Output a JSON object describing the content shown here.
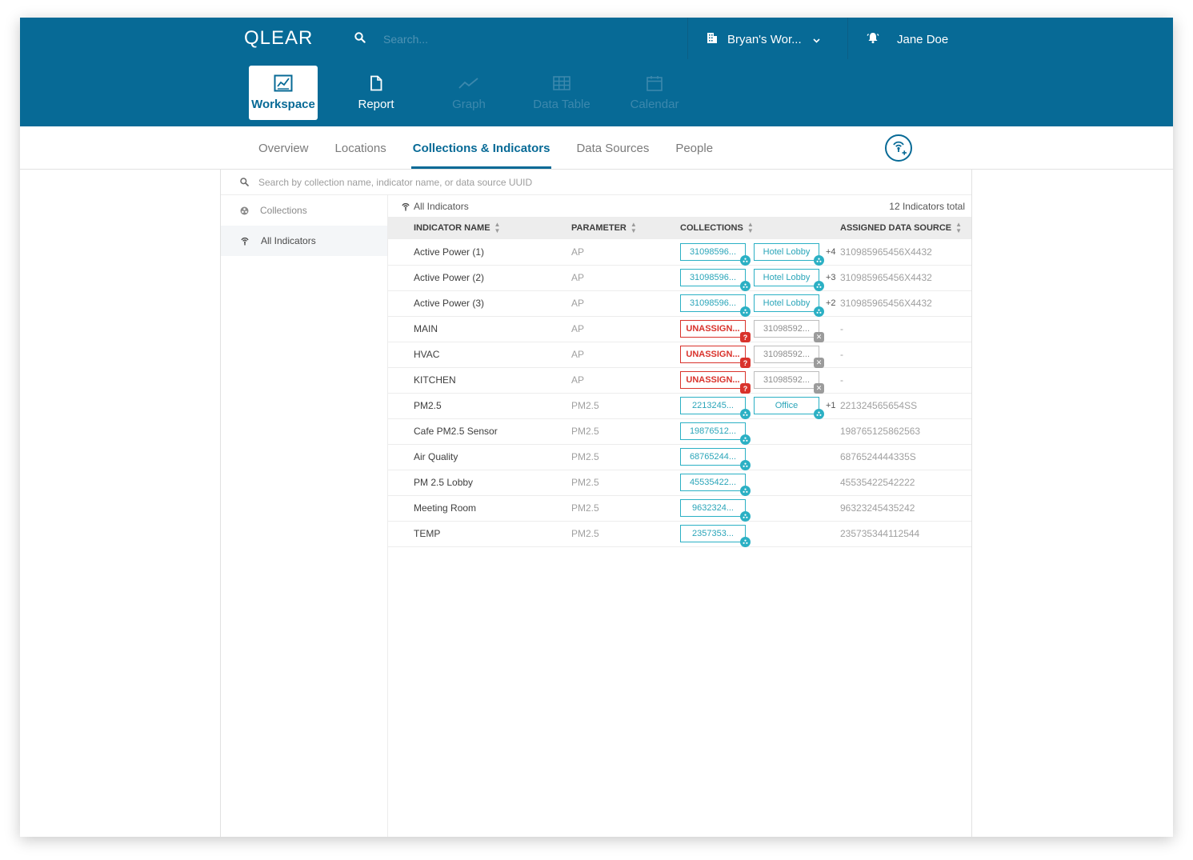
{
  "header": {
    "logo": "QLEAR",
    "search_placeholder": "Search...",
    "workspace_name": "Bryan's Wor...",
    "user_name": "Jane Doe"
  },
  "nav_tabs": [
    {
      "label": "Workspace",
      "icon": "chart-box-icon",
      "state": "active"
    },
    {
      "label": "Report",
      "icon": "document-icon",
      "state": "normal"
    },
    {
      "label": "Graph",
      "icon": "line-graph-icon",
      "state": "disabled"
    },
    {
      "label": "Data Table",
      "icon": "grid-table-icon",
      "state": "disabled"
    },
    {
      "label": "Calendar",
      "icon": "calendar-icon",
      "state": "disabled"
    }
  ],
  "sub_tabs": [
    {
      "label": "Overview",
      "active": false
    },
    {
      "label": "Locations",
      "active": false
    },
    {
      "label": "Collections & Indicators",
      "active": true
    },
    {
      "label": "Data Sources",
      "active": false
    },
    {
      "label": "People",
      "active": false
    }
  ],
  "panel": {
    "search_placeholder": "Search by collection name, indicator name, or data source UUID",
    "sidebar": [
      {
        "label": "Collections",
        "icon": "collection-icon",
        "active": false
      },
      {
        "label": "All Indicators",
        "icon": "indicator-icon",
        "active": true
      }
    ],
    "list_title": "All Indicators",
    "total": "12 Indicators total",
    "columns": [
      "Indicator Name",
      "Parameter",
      "Collections",
      "Assigned Data Source"
    ],
    "rows": [
      {
        "name": "Active Power (1)",
        "param": "AP",
        "chips": [
          {
            "text": "31098596...",
            "type": "teal"
          },
          {
            "text": "Hotel Lobby",
            "type": "teal"
          }
        ],
        "more": "+4",
        "source": "310985965456X4432"
      },
      {
        "name": "Active Power (2)",
        "param": "AP",
        "chips": [
          {
            "text": "31098596...",
            "type": "teal"
          },
          {
            "text": "Hotel Lobby",
            "type": "teal"
          }
        ],
        "more": "+3",
        "source": "310985965456X4432"
      },
      {
        "name": "Active Power (3)",
        "param": "AP",
        "chips": [
          {
            "text": "31098596...",
            "type": "teal"
          },
          {
            "text": "Hotel Lobby",
            "type": "teal"
          }
        ],
        "more": "+2",
        "source": "310985965456X4432"
      },
      {
        "name": "MAIN",
        "param": "AP",
        "chips": [
          {
            "text": "UNASSIGN...",
            "type": "red"
          },
          {
            "text": "31098592...",
            "type": "grey"
          }
        ],
        "more": "",
        "source": "-"
      },
      {
        "name": "HVAC",
        "param": "AP",
        "chips": [
          {
            "text": "UNASSIGN...",
            "type": "red"
          },
          {
            "text": "31098592...",
            "type": "grey"
          }
        ],
        "more": "",
        "source": "-"
      },
      {
        "name": "KITCHEN",
        "param": "AP",
        "chips": [
          {
            "text": "UNASSIGN...",
            "type": "red"
          },
          {
            "text": "31098592...",
            "type": "grey"
          }
        ],
        "more": "",
        "source": "-"
      },
      {
        "name": "PM2.5",
        "param": "PM2.5",
        "chips": [
          {
            "text": "2213245...",
            "type": "teal"
          },
          {
            "text": "Office",
            "type": "teal"
          }
        ],
        "more": "+1",
        "source": "221324565654SS"
      },
      {
        "name": "Cafe PM2.5 Sensor",
        "param": "PM2.5",
        "chips": [
          {
            "text": "19876512...",
            "type": "teal"
          }
        ],
        "more": "",
        "source": "198765125862563"
      },
      {
        "name": "Air Quality",
        "param": "PM2.5",
        "chips": [
          {
            "text": "68765244...",
            "type": "teal"
          }
        ],
        "more": "",
        "source": "6876524444335S"
      },
      {
        "name": "PM 2.5 Lobby",
        "param": "PM2.5",
        "chips": [
          {
            "text": "45535422...",
            "type": "teal"
          }
        ],
        "more": "",
        "source": "45535422542222"
      },
      {
        "name": "Meeting Room",
        "param": "PM2.5",
        "chips": [
          {
            "text": "9632324...",
            "type": "teal"
          }
        ],
        "more": "",
        "source": "96323245435242"
      },
      {
        "name": "TEMP",
        "param": "PM2.5",
        "chips": [
          {
            "text": "2357353...",
            "type": "teal"
          }
        ],
        "more": "",
        "source": "235735344112544"
      }
    ]
  },
  "colors": {
    "brand": "#076a96",
    "teal": "#2bb0c4",
    "danger": "#d9322b",
    "muted": "#9b9b9b"
  }
}
